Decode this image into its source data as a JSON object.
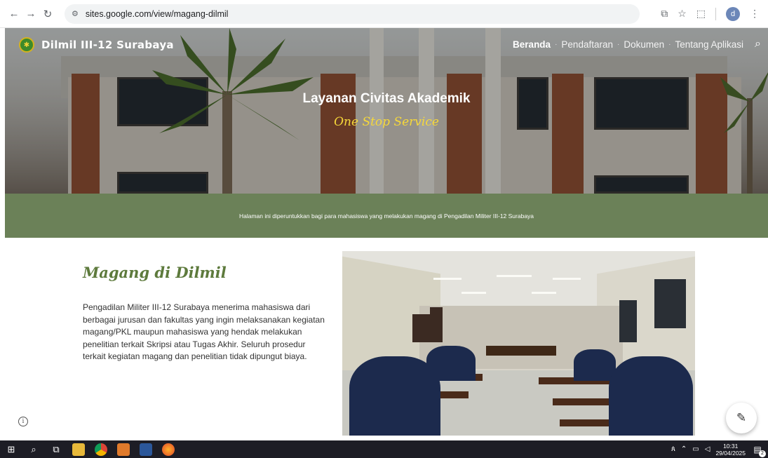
{
  "browser": {
    "url": "sites.google.com/view/magang-dilmil",
    "profile_initial": "d"
  },
  "site": {
    "brand": "Dilmil III-12 Surabaya",
    "nav": {
      "beranda": "Beranda",
      "pendaftaran": "Pendaftaran",
      "dokumen": "Dokumen",
      "tentang": "Tentang Aplikasi",
      "separator": "·"
    }
  },
  "hero": {
    "title": "Layanan Civitas Akademik",
    "subtitle": "One Stop Service"
  },
  "banner": {
    "text": "Halaman ini diperuntukkan bagi para mahasiswa yang melakukan magang di Pengadilan Militer III-12 Surabaya"
  },
  "content": {
    "title": "Magang di Dilmil",
    "body": "Pengadilan Militer III-12 Surabaya menerima mahasiswa dari berbagai jurusan dan fakultas yang ingin melaksanakan kegiatan magang/PKL maupun mahasiswa yang hendak melakukan penelitian terkait Skripsi atau Tugas Akhir. Seluruh prosedur terkait kegiatan magang dan penelitian tidak dipungut biaya."
  },
  "taskbar": {
    "time": "10:31",
    "date": "29/04/2025",
    "notification_count": "2"
  },
  "colors": {
    "banner_green": "#6b8158",
    "title_green": "#5d7a3c",
    "subtitle_yellow": "#f6d83a"
  }
}
